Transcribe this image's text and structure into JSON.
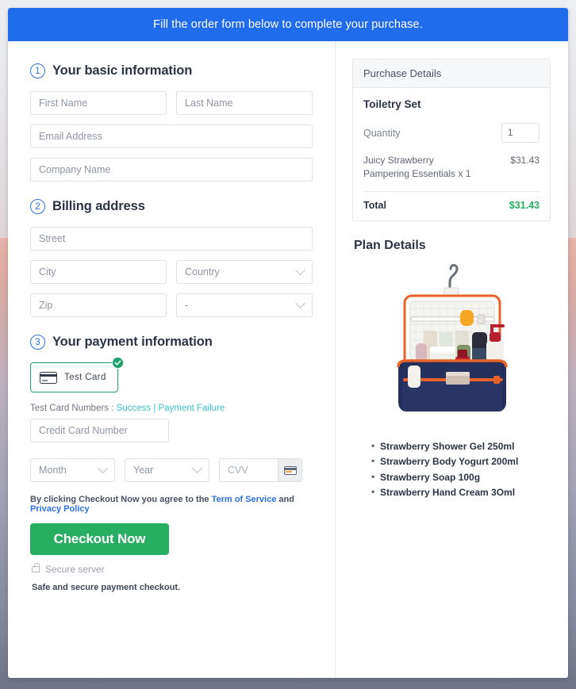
{
  "banner": {
    "text": "Fill the order form below to complete your purchase."
  },
  "sections": {
    "basic": {
      "number": "1",
      "title": "Your basic information"
    },
    "billing": {
      "number": "2",
      "title": "Billing address"
    },
    "payment": {
      "number": "3",
      "title": "Your payment information"
    }
  },
  "fields": {
    "first_name": {
      "placeholder": "First Name",
      "value": ""
    },
    "last_name": {
      "placeholder": "Last Name",
      "value": ""
    },
    "email": {
      "placeholder": "Email Address",
      "value": ""
    },
    "company": {
      "placeholder": "Company Name",
      "value": ""
    },
    "street": {
      "placeholder": "Street",
      "value": ""
    },
    "city": {
      "placeholder": "City",
      "value": ""
    },
    "country": {
      "placeholder": "Country",
      "value": ""
    },
    "zip": {
      "placeholder": "Zip",
      "value": ""
    },
    "state": {
      "placeholder": "-",
      "value": ""
    },
    "credit_card": {
      "placeholder": "Credit Card Number",
      "value": ""
    },
    "month": {
      "placeholder": "Month",
      "value": ""
    },
    "year": {
      "placeholder": "Year",
      "value": ""
    },
    "cvv": {
      "placeholder": "CVV",
      "value": ""
    }
  },
  "payment_method": {
    "label": "Test Card",
    "selected": true,
    "icon": "credit-card-icon",
    "check_icon": "check-circle-icon",
    "border_color": "#22a06b"
  },
  "test_numbers": {
    "prefix": "Test Card Numbers : ",
    "success_link": "Success",
    "separator": " | ",
    "failure_link": "Payment Failure",
    "link_color": "#3fc1c9"
  },
  "terms": {
    "prefix": "By clicking Checkout Now you agree to the ",
    "tos_link": "Term of Service",
    "middle": " and ",
    "privacy_link": "Privacy Policy",
    "link_color": "#2a72e8"
  },
  "checkout": {
    "button_label": "Checkout Now",
    "button_color": "#27ae60",
    "secure_text": "Secure server",
    "secure_icon": "lock-icon",
    "safe_note": "Safe and secure payment checkout."
  },
  "purchase_details": {
    "header": "Purchase Details",
    "product": "Toiletry Set",
    "quantity_label": "Quantity",
    "quantity_value": "1",
    "line_item": {
      "name": "Juicy Strawberry Pampering Essentials x 1",
      "price": "$31.43"
    },
    "total_label": "Total",
    "total_value": "$31.43",
    "total_color": "#27ae60"
  },
  "plan_details": {
    "title": "Plan Details",
    "image_alt": "navy toiletry travel bag with orange trim filled with bottles",
    "items": [
      "Strawberry Shower Gel 250ml",
      "Strawberry Body Yogurt 200ml",
      "Strawberry Soap 100g",
      "Strawberry Hand Cream 3Oml"
    ]
  }
}
